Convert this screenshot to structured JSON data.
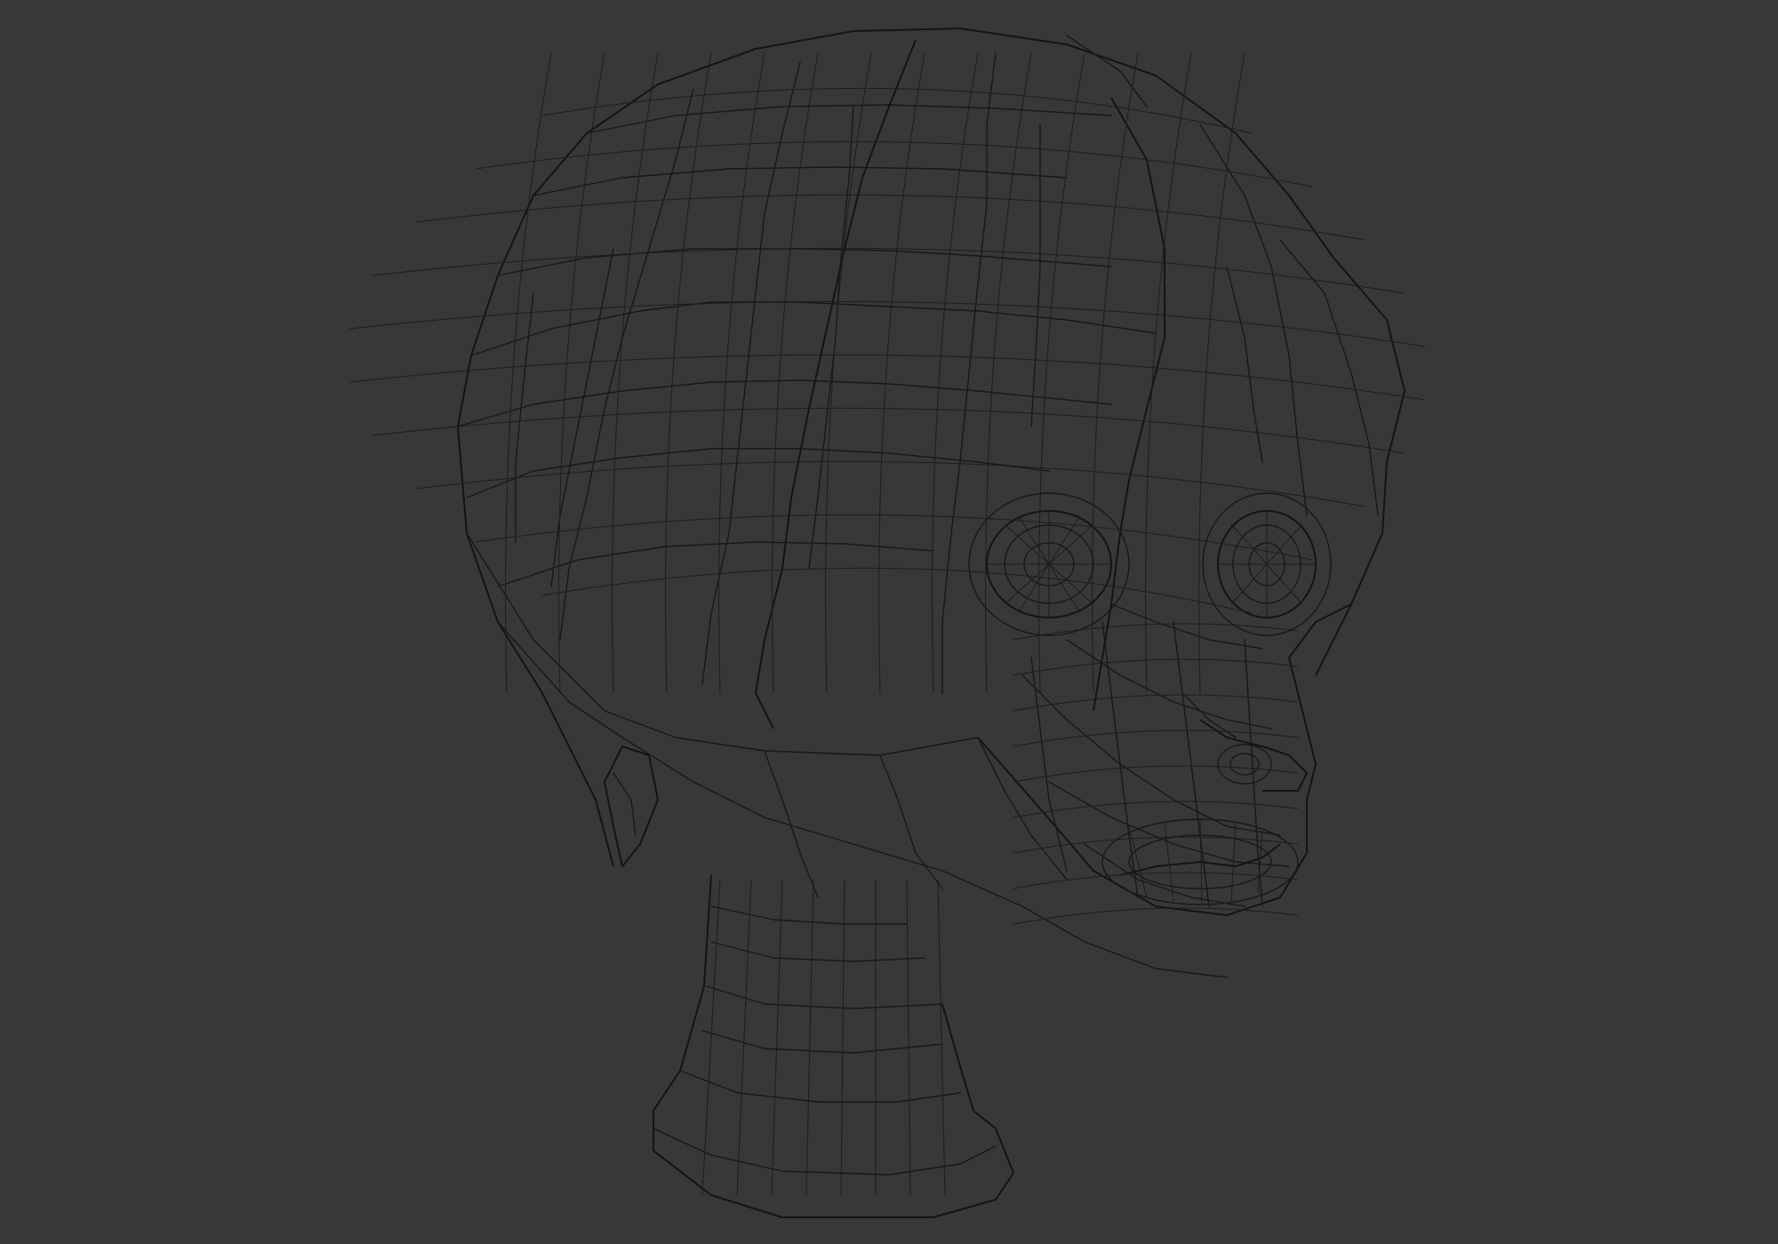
{
  "viewport": {
    "background": "#383838",
    "wire_color": "#181818",
    "shading_mode": "wireframe"
  },
  "model": {
    "parts": [
      "hair",
      "face",
      "left-eye",
      "right-eye",
      "nose",
      "mouth",
      "ear",
      "neck"
    ]
  }
}
